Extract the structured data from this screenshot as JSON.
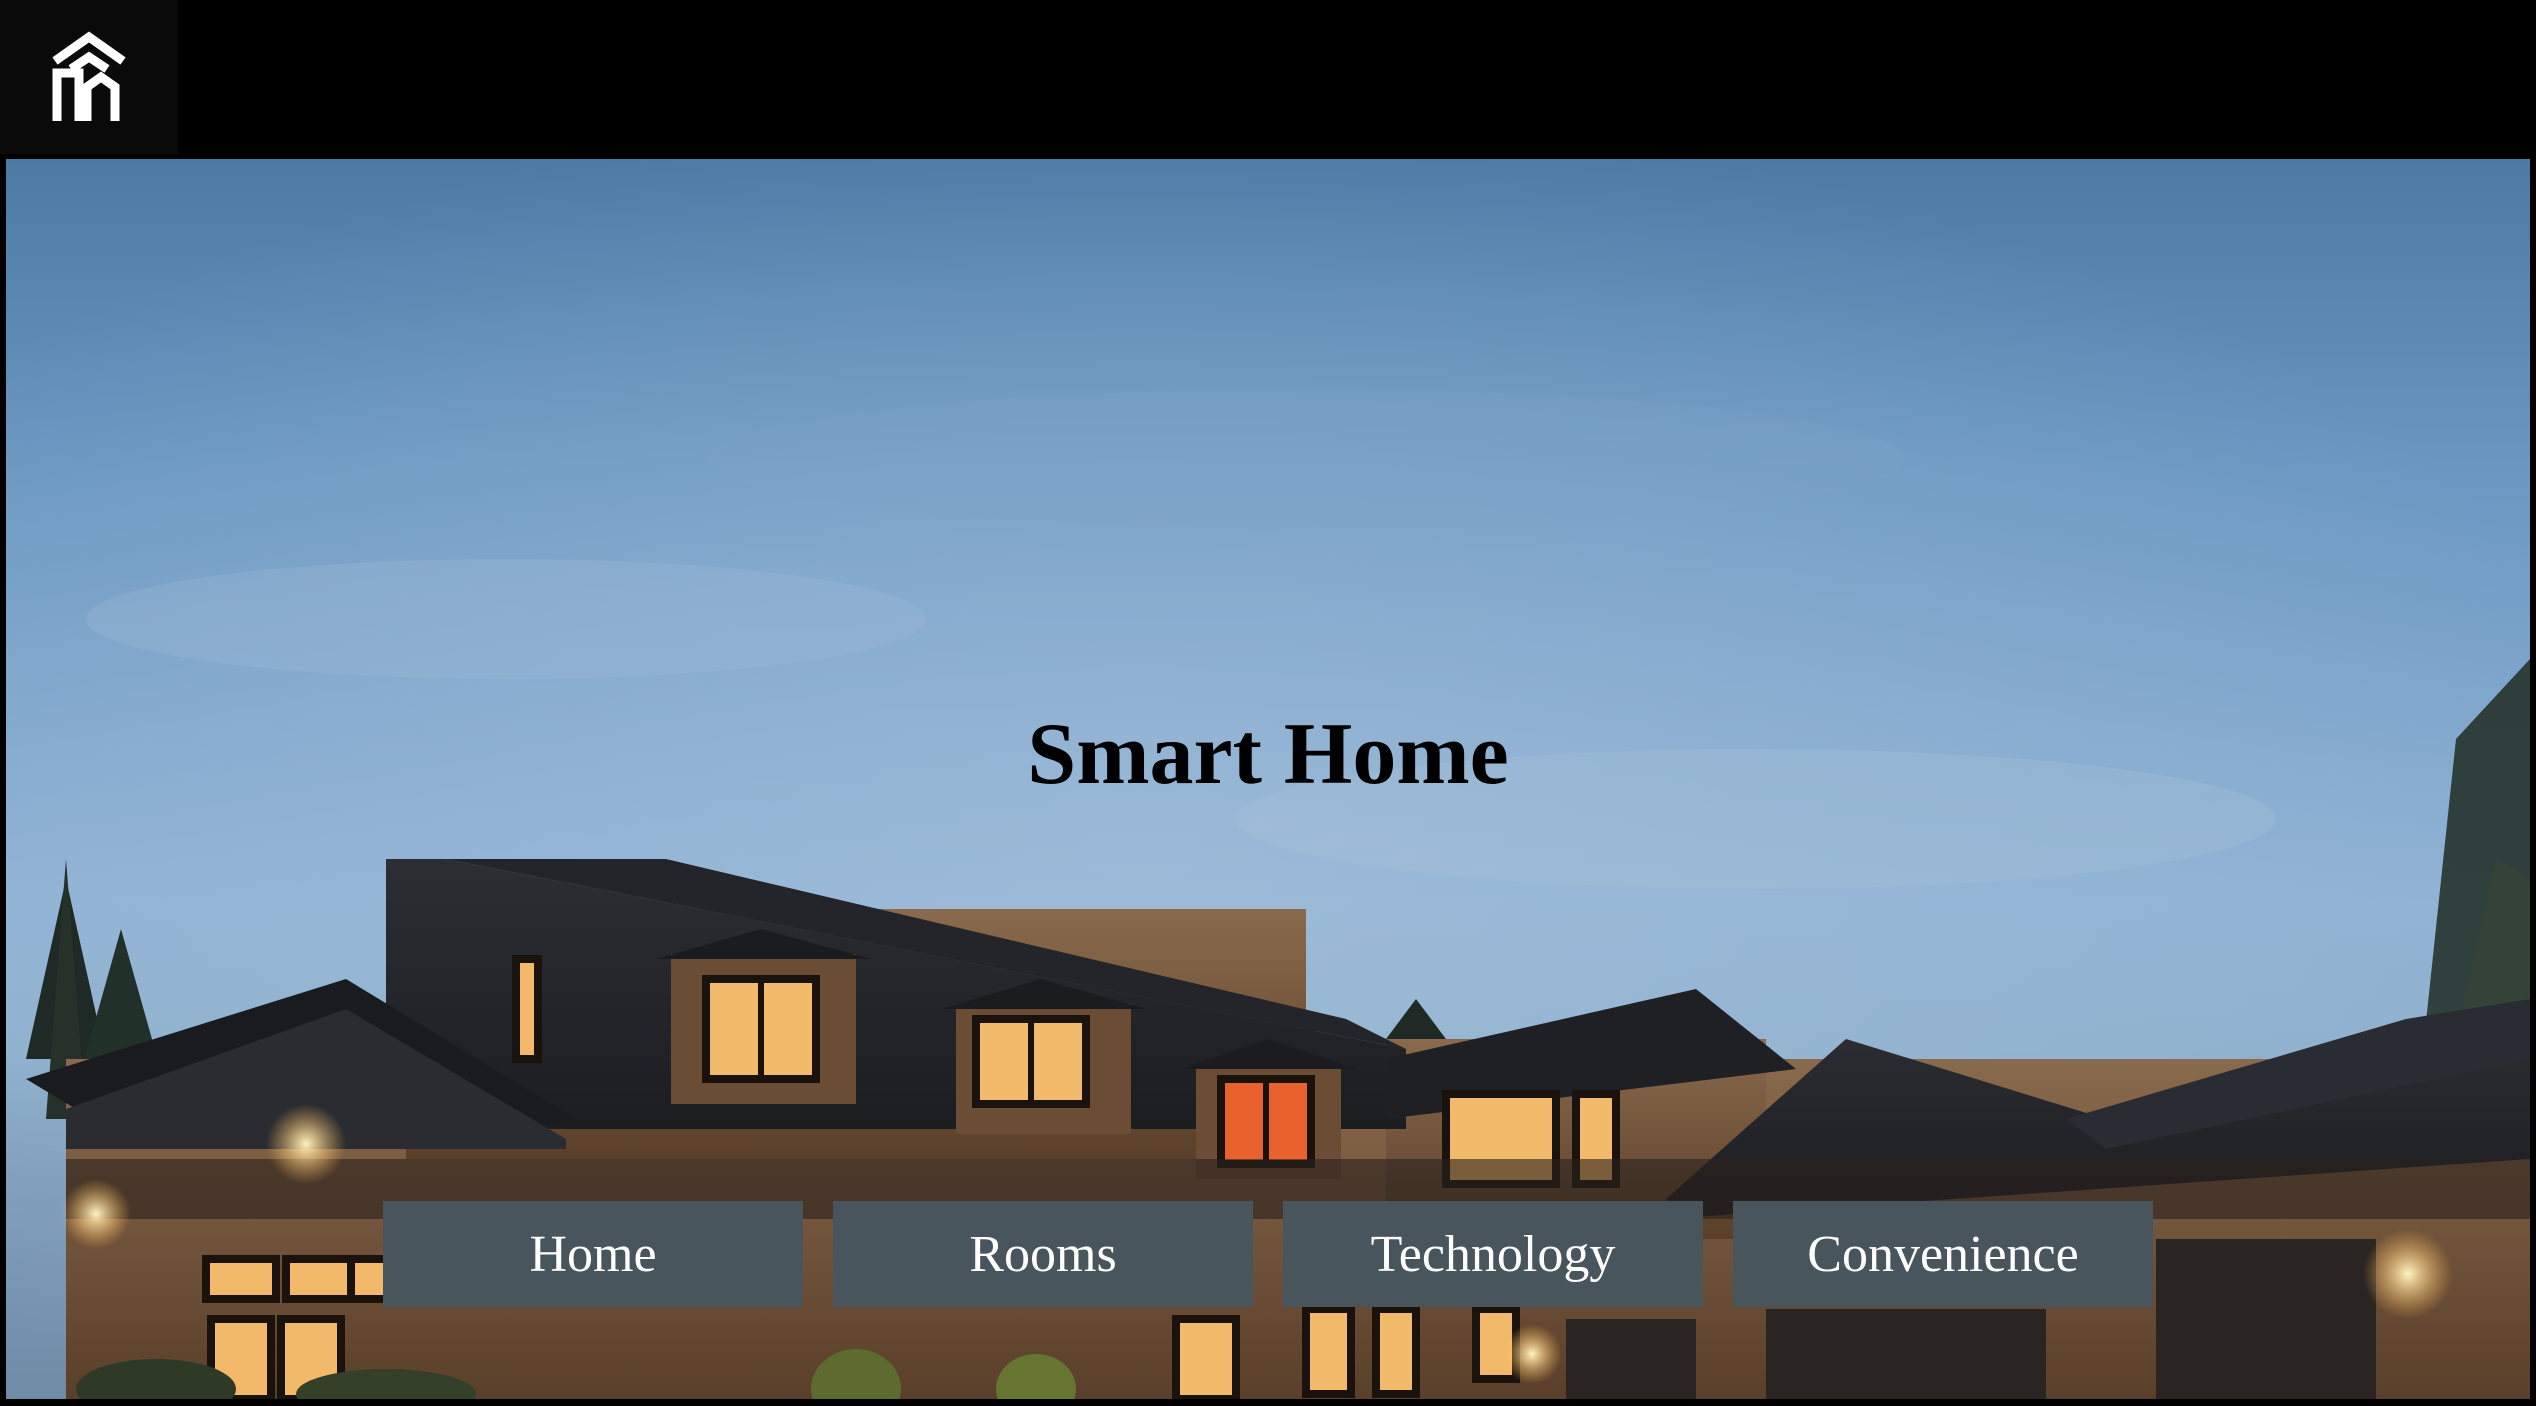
{
  "header": {
    "logo_icon": "smart-home-logo-icon",
    "background_color": "#000000"
  },
  "hero": {
    "title": "Smart Home",
    "background_image": "house-at-dusk-photo"
  },
  "nav": {
    "items": [
      {
        "label": "Home"
      },
      {
        "label": "Rooms"
      },
      {
        "label": "Technology"
      },
      {
        "label": "Convenience"
      }
    ],
    "button_color": "#48555c",
    "text_color": "#ffffff"
  }
}
